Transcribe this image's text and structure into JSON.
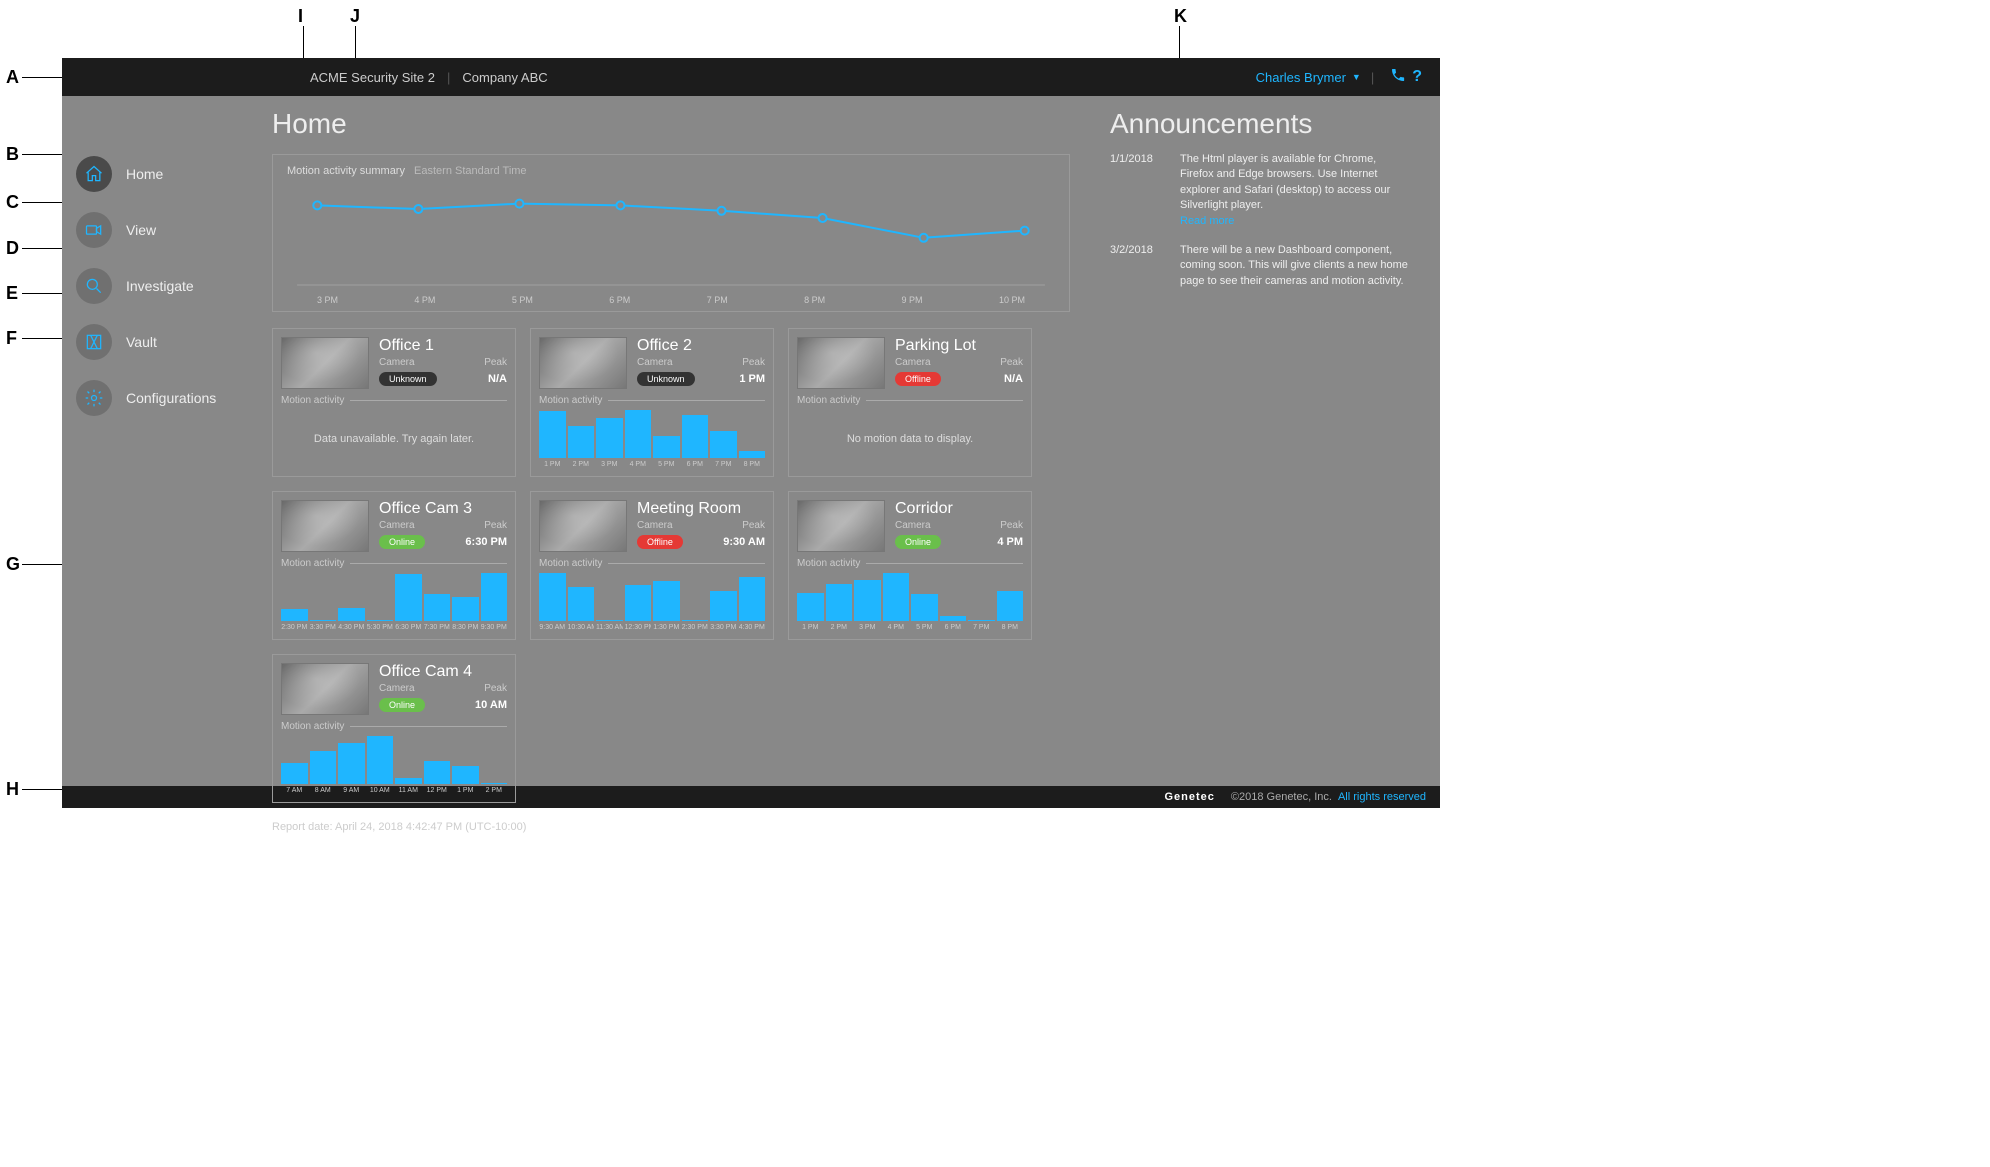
{
  "callouts": {
    "A": "A",
    "B": "B",
    "C": "C",
    "D": "D",
    "E": "E",
    "F": "F",
    "G": "G",
    "H": "H",
    "I": "I",
    "J": "J",
    "K": "K"
  },
  "topbar": {
    "site_name": "ACME Security Site 2",
    "company": "Company ABC",
    "user": "Charles Brymer"
  },
  "sidebar": {
    "items": [
      {
        "label": "Home"
      },
      {
        "label": "View"
      },
      {
        "label": "Investigate"
      },
      {
        "label": "Vault"
      },
      {
        "label": "Configurations"
      }
    ]
  },
  "page": {
    "title": "Home",
    "report_date": "Report date: April 24, 2018 4:42:47 PM (UTC-10:00)"
  },
  "summary": {
    "title": "Motion activity summary",
    "timezone": "Eastern Standard Time",
    "x_labels": [
      "3 PM",
      "4 PM",
      "5 PM",
      "6 PM",
      "7 PM",
      "8 PM",
      "9 PM",
      "10 PM"
    ]
  },
  "chart_data": {
    "type": "line",
    "title": "Motion activity summary",
    "xlabel": "",
    "ylabel": "",
    "categories": [
      "3 PM",
      "4 PM",
      "5 PM",
      "6 PM",
      "7 PM",
      "8 PM",
      "9 PM",
      "10 PM"
    ],
    "values": [
      84,
      80,
      86,
      84,
      78,
      70,
      48,
      56
    ],
    "ylim": [
      0,
      100
    ]
  },
  "labels": {
    "camera": "Camera",
    "peak": "Peak",
    "motion_activity": "Motion activity",
    "data_unavailable": "Data unavailable. Try again later.",
    "no_motion_data": "No motion data to display.",
    "read_more": "Read more"
  },
  "status_text": {
    "unknown": "Unknown",
    "offline": "Offline",
    "online": "Online"
  },
  "cameras": [
    {
      "name": "Office 1",
      "status": "unknown",
      "peak": "N/A",
      "motion": {
        "type": "message",
        "message_key": "data_unavailable"
      }
    },
    {
      "name": "Office  2",
      "status": "unknown",
      "peak": "1 PM",
      "motion": {
        "type": "bars",
        "labels": [
          "1 PM",
          "2 PM",
          "3 PM",
          "4 PM",
          "5 PM",
          "6 PM",
          "7 PM",
          "8 PM"
        ],
        "values": [
          70,
          48,
          60,
          72,
          33,
          65,
          40,
          10
        ]
      }
    },
    {
      "name": "Parking Lot",
      "status": "offline",
      "peak": "N/A",
      "motion": {
        "type": "message",
        "message_key": "no_motion_data"
      }
    },
    {
      "name": "Office Cam 3",
      "status": "online",
      "peak": "6:30 PM",
      "motion": {
        "type": "bars",
        "labels": [
          "2:30 PM",
          "3:30 PM",
          "4:30 PM",
          "5:30 PM",
          "6:30 PM",
          "7:30 PM",
          "8:30 PM",
          "9:30 PM"
        ],
        "values": [
          20,
          0,
          22,
          0,
          78,
          45,
          40,
          80
        ]
      }
    },
    {
      "name": "Meeting Room",
      "status": "offline",
      "peak": "9:30 AM",
      "motion": {
        "type": "bars",
        "labels": [
          "9:30 AM",
          "10:30 AM",
          "11:30 AM",
          "12:30 PM",
          "1:30 PM",
          "2:30 PM",
          "3:30 PM",
          "4:30 PM"
        ],
        "values": [
          60,
          42,
          0,
          45,
          50,
          0,
          38,
          55
        ]
      }
    },
    {
      "name": "Corridor",
      "status": "online",
      "peak": "4 PM",
      "motion": {
        "type": "bars",
        "labels": [
          "1 PM",
          "2 PM",
          "3 PM",
          "4 PM",
          "5 PM",
          "6 PM",
          "7 PM",
          "8 PM"
        ],
        "values": [
          42,
          55,
          62,
          72,
          40,
          8,
          0,
          45
        ]
      }
    },
    {
      "name": "Office Cam 4",
      "status": "online",
      "peak": "10 AM",
      "motion": {
        "type": "bars",
        "labels": [
          "7 AM",
          "8 AM",
          "9 AM",
          "10 AM",
          "11 AM",
          "12 PM",
          "1 PM",
          "2 PM"
        ],
        "values": [
          35,
          55,
          68,
          80,
          10,
          38,
          30,
          0
        ]
      }
    }
  ],
  "announcements": {
    "title": "Announcements",
    "items": [
      {
        "date": "1/1/2018",
        "text": "The Html player is available for Chrome, Firefox and Edge browsers. Use Internet explorer and Safari (desktop) to access our Silverlight player.",
        "read_more": true
      },
      {
        "date": "3/2/2018",
        "text": "There will be a new Dashboard component, coming soon. This will give clients a new home page to see their cameras and motion activity.",
        "read_more": false
      }
    ]
  },
  "footer": {
    "brand": "Genetec",
    "copyright": "©2018 Genetec, Inc.",
    "rights": "All rights reserved"
  }
}
